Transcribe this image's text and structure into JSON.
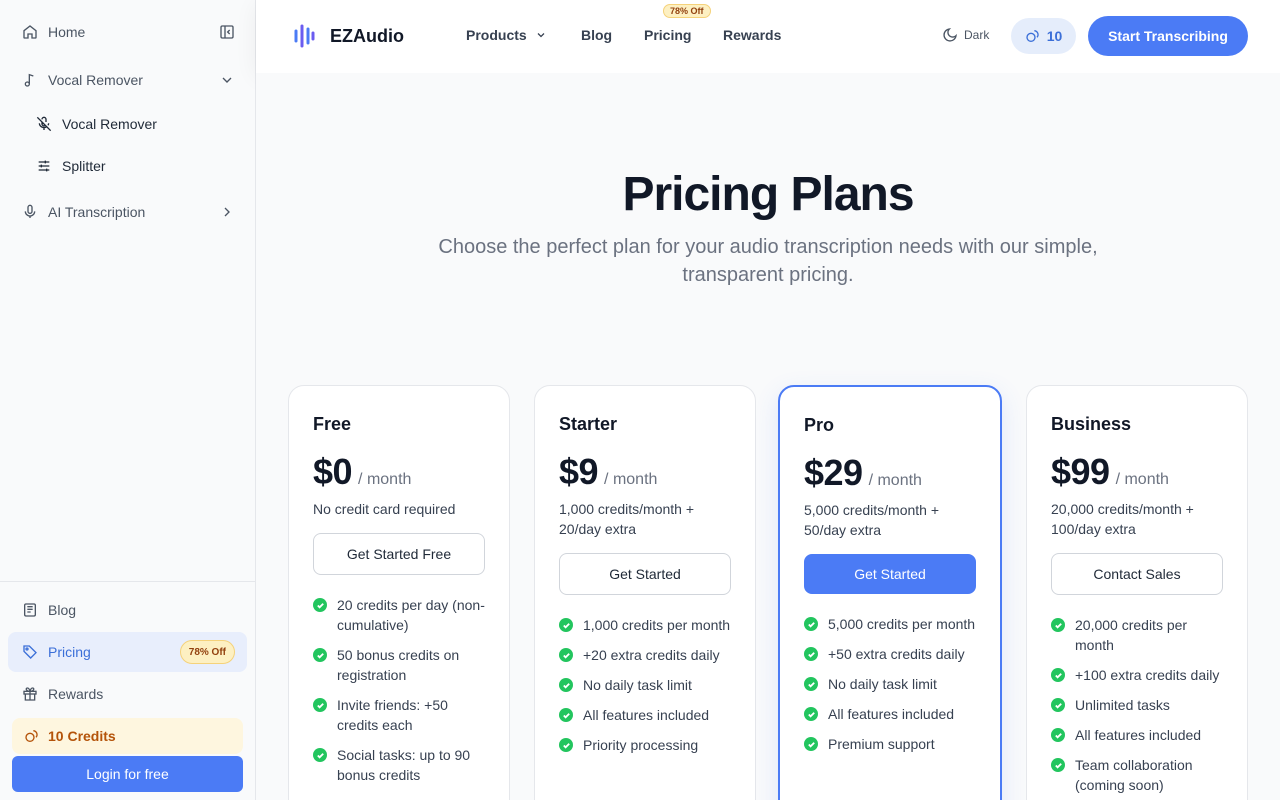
{
  "sidebar": {
    "home": "Home",
    "vocal_remover_group": "Vocal Remover",
    "vocal_remover": "Vocal Remover",
    "splitter": "Splitter",
    "ai_transcription": "AI Transcription",
    "blog": "Blog",
    "pricing": "Pricing",
    "pricing_badge": "78% Off",
    "rewards": "Rewards",
    "credits": "10 Credits",
    "login": "Login for free"
  },
  "header": {
    "brand": "EZAudio",
    "nav": [
      "Products",
      "Blog",
      "Pricing",
      "Rewards"
    ],
    "pricing_badge": "78% Off",
    "theme_toggle": "Dark",
    "credits": "10",
    "cta": "Start Transcribing"
  },
  "main": {
    "title": "Pricing Plans",
    "subtitle": "Choose the perfect plan for your audio transcription needs with our simple, transparent pricing."
  },
  "plans": [
    {
      "name": "Free",
      "price": "$0",
      "period": "/ month",
      "desc": "No credit card required",
      "button": "Get Started Free",
      "features": [
        "20 credits per day (non-cumulative)",
        "50 bonus credits on registration",
        "Invite friends: +50 credits each",
        "Social tasks: up to 90 bonus credits"
      ]
    },
    {
      "name": "Starter",
      "price": "$9",
      "period": "/ month",
      "desc": "1,000 credits/month + 20/day extra",
      "button": "Get Started",
      "features": [
        "1,000 credits per month",
        "+20 extra credits daily",
        "No daily task limit",
        "All features included",
        "Priority processing"
      ]
    },
    {
      "name": "Pro",
      "price": "$29",
      "period": "/ month",
      "desc": "5,000 credits/month + 50/day extra",
      "button": "Get Started",
      "features": [
        "5,000 credits per month",
        "+50 extra credits daily",
        "No daily task limit",
        "All features included",
        "Premium support"
      ]
    },
    {
      "name": "Business",
      "price": "$99",
      "period": "/ month",
      "desc": "20,000 credits/month + 100/day extra",
      "button": "Contact Sales",
      "features": [
        "20,000 credits per month",
        "+100 extra credits daily",
        "Unlimited tasks",
        "All features included",
        "Team collaboration (coming soon)"
      ]
    }
  ],
  "colors": {
    "accent": "#4b7bf5",
    "check": "#22c55e",
    "badge_bg": "#fdf0c2",
    "credits_text": "#b45309"
  },
  "icons": [
    "home-icon",
    "panel-collapse-icon",
    "music-note-icon",
    "chevron-down-icon",
    "mic-off-icon",
    "sliders-icon",
    "mic-icon",
    "chevron-right-icon",
    "newspaper-icon",
    "tag-icon",
    "gift-icon",
    "coins-icon",
    "waveform-logo-icon",
    "moon-icon",
    "check-icon"
  ]
}
